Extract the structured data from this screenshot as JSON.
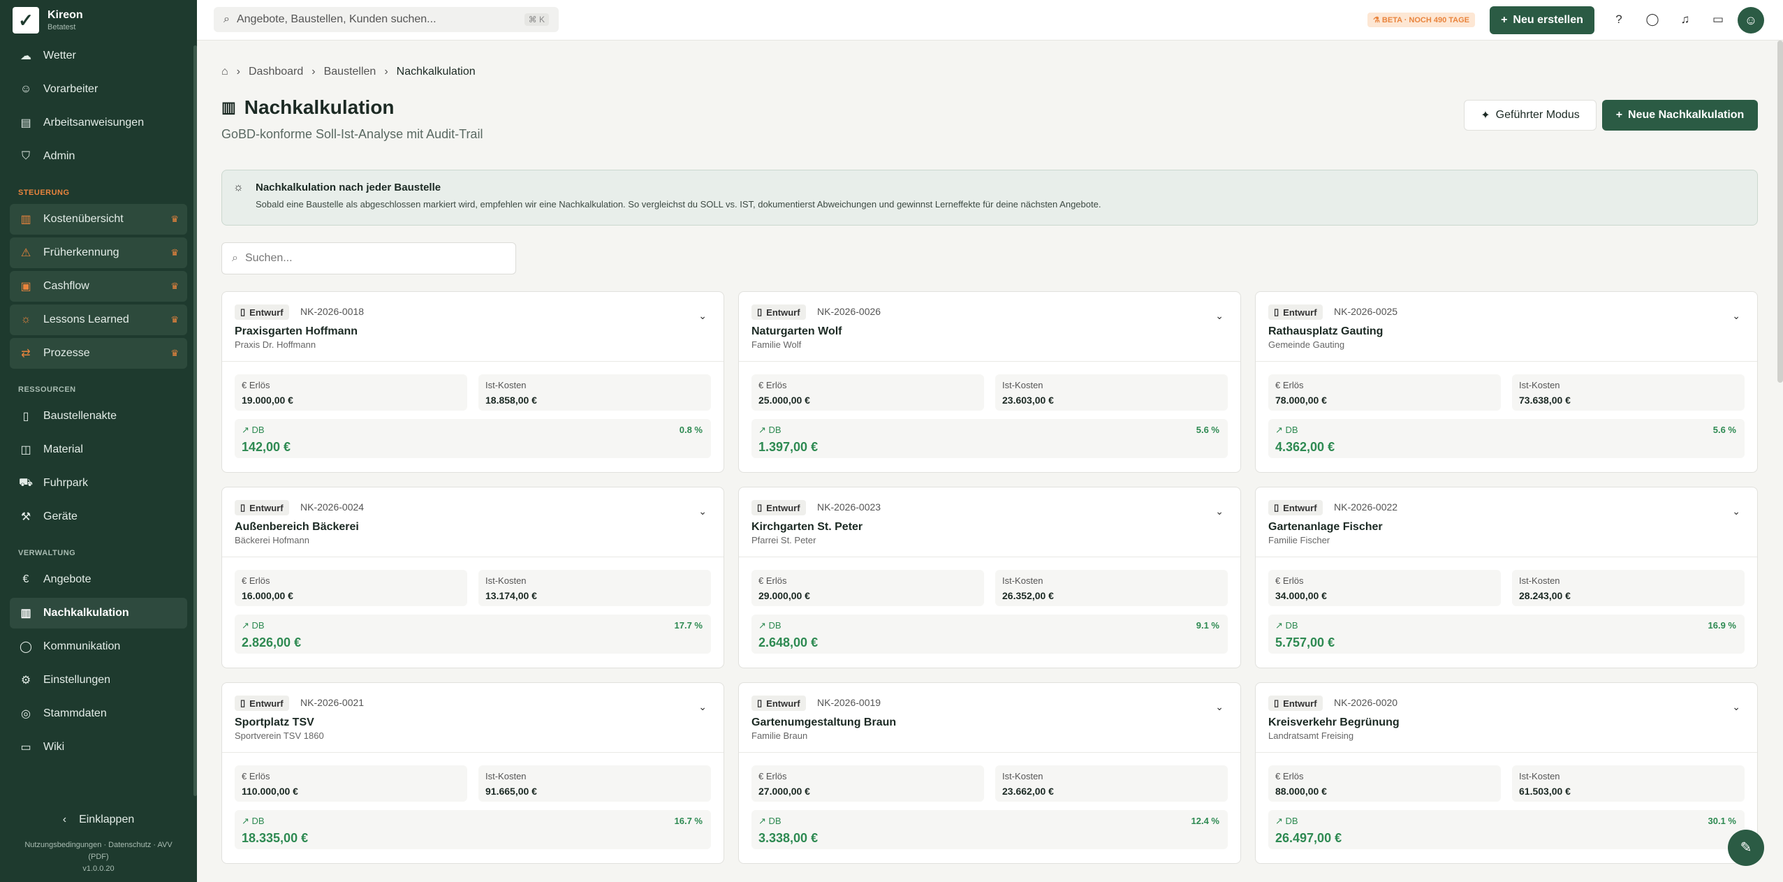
{
  "brand": {
    "name": "Kireon",
    "sub": "Betatest"
  },
  "search_top": {
    "placeholder": "Angebote, Baustellen, Kunden suchen...",
    "shortcut": "⌘ K"
  },
  "beta": "BETA · NOCH 490 TAGE",
  "new_button": "Neu erstellen",
  "nav_top": [
    {
      "label": "Wetter",
      "icon": "cloud-icon"
    },
    {
      "label": "Vorarbeiter",
      "icon": "user-icon"
    },
    {
      "label": "Arbeitsanweisungen",
      "icon": "clipboard-icon"
    },
    {
      "label": "Admin",
      "icon": "shield-icon"
    }
  ],
  "sec_steuerung": "STEUERUNG",
  "nav_steuerung": [
    {
      "label": "Kostenübersicht",
      "icon": "chart-icon"
    },
    {
      "label": "Früherkennung",
      "icon": "warning-icon"
    },
    {
      "label": "Cashflow",
      "icon": "wallet-icon"
    },
    {
      "label": "Lessons Learned",
      "icon": "bulb-icon"
    },
    {
      "label": "Prozesse",
      "icon": "workflow-icon"
    }
  ],
  "sec_ressourcen": "RESSOURCEN",
  "nav_ressourcen": [
    {
      "label": "Baustellenakte",
      "icon": "file-icon"
    },
    {
      "label": "Material",
      "icon": "box-icon"
    },
    {
      "label": "Fuhrpark",
      "icon": "truck-icon"
    },
    {
      "label": "Geräte",
      "icon": "wrench-icon"
    }
  ],
  "sec_verwaltung": "VERWALTUNG",
  "nav_verwaltung": [
    {
      "label": "Angebote",
      "icon": "euro-icon"
    },
    {
      "label": "Nachkalkulation",
      "icon": "chart-icon"
    },
    {
      "label": "Kommunikation",
      "icon": "chat-icon"
    },
    {
      "label": "Einstellungen",
      "icon": "gear-icon"
    },
    {
      "label": "Stammdaten",
      "icon": "database-icon"
    },
    {
      "label": "Wiki",
      "icon": "book-icon"
    }
  ],
  "collapse": "Einklappen",
  "legal": "Nutzungsbedingungen · Datenschutz · AVV (PDF)",
  "version": "v1.0.0.20",
  "breadcrumb": [
    "Dashboard",
    "Baustellen",
    "Nachkalkulation"
  ],
  "page_title": "Nachkalkulation",
  "page_subtitle": "GoBD-konforme Soll-Ist-Analyse mit Audit-Trail",
  "guided_button": "Geführter Modus",
  "new_nk_button": "Neue Nachkalkulation",
  "hint": {
    "title": "Nachkalkulation nach jeder Baustelle",
    "text": "Sobald eine Baustelle als abgeschlossen markiert wird, empfehlen wir eine Nachkalkulation. So vergleichst du SOLL vs. IST, dokumentierst Abweichungen und gewinnst Lerneffekte für deine nächsten Angebote."
  },
  "list_search_placeholder": "Suchen...",
  "labels": {
    "status": "Entwurf",
    "erloes": "Erlös",
    "ist": "Ist-Kosten",
    "db": "DB"
  },
  "cards": [
    {
      "code": "NK-2026-0018",
      "name": "Praxisgarten Hoffmann",
      "customer": "Praxis Dr. Hoffmann",
      "erloes": "19.000,00 €",
      "ist": "18.858,00 €",
      "db": "142,00 €",
      "pct": "0.8 %"
    },
    {
      "code": "NK-2026-0026",
      "name": "Naturgarten Wolf",
      "customer": "Familie Wolf",
      "erloes": "25.000,00 €",
      "ist": "23.603,00 €",
      "db": "1.397,00 €",
      "pct": "5.6 %"
    },
    {
      "code": "NK-2026-0025",
      "name": "Rathausplatz Gauting",
      "customer": "Gemeinde Gauting",
      "erloes": "78.000,00 €",
      "ist": "73.638,00 €",
      "db": "4.362,00 €",
      "pct": "5.6 %"
    },
    {
      "code": "NK-2026-0024",
      "name": "Außenbereich Bäckerei",
      "customer": "Bäckerei Hofmann",
      "erloes": "16.000,00 €",
      "ist": "13.174,00 €",
      "db": "2.826,00 €",
      "pct": "17.7 %"
    },
    {
      "code": "NK-2026-0023",
      "name": "Kirchgarten St. Peter",
      "customer": "Pfarrei St. Peter",
      "erloes": "29.000,00 €",
      "ist": "26.352,00 €",
      "db": "2.648,00 €",
      "pct": "9.1 %"
    },
    {
      "code": "NK-2026-0022",
      "name": "Gartenanlage Fischer",
      "customer": "Familie Fischer",
      "erloes": "34.000,00 €",
      "ist": "28.243,00 €",
      "db": "5.757,00 €",
      "pct": "16.9 %"
    },
    {
      "code": "NK-2026-0021",
      "name": "Sportplatz TSV",
      "customer": "Sportverein TSV 1860",
      "erloes": "110.000,00 €",
      "ist": "91.665,00 €",
      "db": "18.335,00 €",
      "pct": "16.7 %"
    },
    {
      "code": "NK-2026-0019",
      "name": "Gartenumgestaltung Braun",
      "customer": "Familie Braun",
      "erloes": "27.000,00 €",
      "ist": "23.662,00 €",
      "db": "3.338,00 €",
      "pct": "12.4 %"
    },
    {
      "code": "NK-2026-0020",
      "name": "Kreisverkehr Begrünung",
      "customer": "Landratsamt Freising",
      "erloes": "88.000,00 €",
      "ist": "61.503,00 €",
      "db": "26.497,00 €",
      "pct": "30.1 %"
    }
  ]
}
